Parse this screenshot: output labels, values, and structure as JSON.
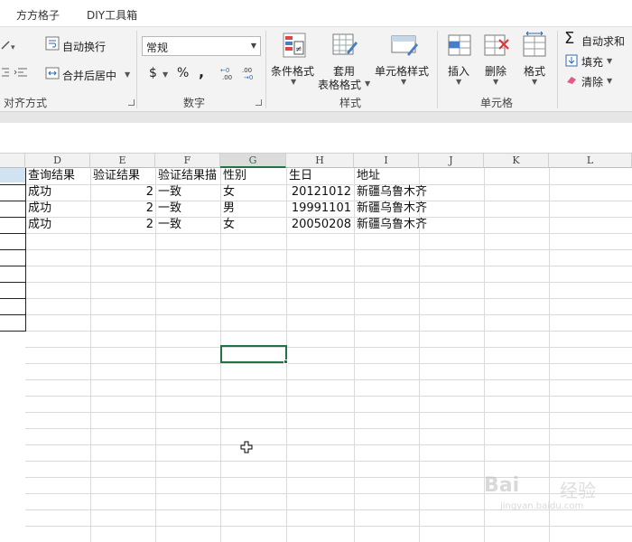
{
  "tabs": [
    "方方格子",
    "DIY工具箱"
  ],
  "ribbon": {
    "alignment": {
      "wrap_text": "自动换行",
      "merge_center": "合并后居中",
      "group_label": "对齐方式"
    },
    "number": {
      "format_value": "常规",
      "currency": "$",
      "percent": "%",
      "comma": ",",
      "group_label": "数字"
    },
    "styles": {
      "conditional": "条件格式",
      "table_format_1": "套用",
      "table_format_2": "表格格式",
      "cell_styles": "单元格样式",
      "group_label": "样式"
    },
    "cells": {
      "insert": "插入",
      "delete": "删除",
      "format": "格式",
      "group_label": "单元格"
    },
    "editing": {
      "autosum": "自动求和",
      "fill": "填充",
      "clear": "清除"
    }
  },
  "columns": [
    "D",
    "E",
    "F",
    "G",
    "H",
    "I",
    "J",
    "K",
    "L"
  ],
  "selected_column": "G",
  "table": {
    "headers": [
      "查询结果",
      "验证结果",
      "验证结果描",
      "性别",
      "生日",
      "地址"
    ],
    "rows": [
      [
        "成功",
        "2",
        "一致",
        "女",
        "20121012",
        "新疆乌鲁木齐"
      ],
      [
        "成功",
        "2",
        "一致",
        "男",
        "19991101",
        "新疆乌鲁木齐"
      ],
      [
        "成功",
        "2",
        "一致",
        "女",
        "20050208",
        "新疆乌鲁木齐"
      ]
    ]
  },
  "watermark": {
    "brand": "Bai",
    "suffix": "经验",
    "url": "jingyan.baidu.com"
  },
  "colors": {
    "accent": "#217346",
    "ribbon_bg": "#f3f3f3"
  }
}
